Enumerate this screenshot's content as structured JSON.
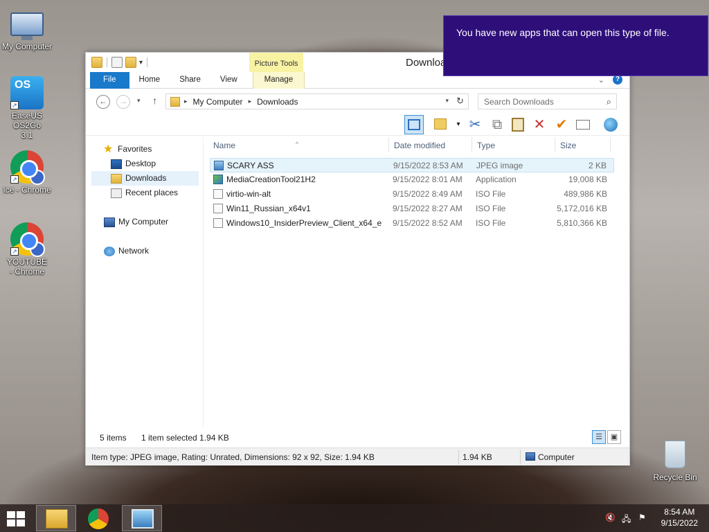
{
  "desktop": {
    "icons": [
      {
        "label": "My Computer"
      },
      {
        "label": "EaseUS OS2Go 3.1"
      },
      {
        "label": "Ice - Chrome"
      },
      {
        "label": "YOUTUBE - Chrome"
      },
      {
        "label": "Recycle Bin"
      }
    ],
    "easeus_logo_text": "OS"
  },
  "notification": {
    "text": "You have new apps that can open this type of file."
  },
  "window": {
    "title": "Downloads",
    "contextual_group": "Picture Tools",
    "tabs": [
      "File",
      "Home",
      "Share",
      "View",
      "Manage"
    ],
    "help_label": "?",
    "address": {
      "crumbs": [
        "My Computer",
        "Downloads"
      ]
    },
    "search": {
      "placeholder": "Search Downloads"
    },
    "nav": {
      "favorites": "Favorites",
      "items": [
        "Desktop",
        "Downloads",
        "Recent places"
      ],
      "computer": "My Computer",
      "network": "Network"
    },
    "columns": [
      "Name",
      "Date modified",
      "Type",
      "Size"
    ],
    "files": [
      {
        "name": "SCARY ASS",
        "date": "9/15/2022 8:53 AM",
        "type": "JPEG image",
        "size": "2 KB",
        "icon": "image-file-icon"
      },
      {
        "name": "MediaCreationTool21H2",
        "date": "9/15/2022 8:01 AM",
        "type": "Application",
        "size": "19,008 KB",
        "icon": "application-icon"
      },
      {
        "name": "virtio-win-alt",
        "date": "9/15/2022 8:49 AM",
        "type": "ISO File",
        "size": "489,986 KB",
        "icon": "iso-file-icon"
      },
      {
        "name": "Win11_Russian_x64v1",
        "date": "9/15/2022 8:27 AM",
        "type": "ISO File",
        "size": "5,172,016 KB",
        "icon": "iso-file-icon"
      },
      {
        "name": "Windows10_InsiderPreview_Client_x64_e...",
        "date": "9/15/2022 8:52 AM",
        "type": "ISO File",
        "size": "5,810,366 KB",
        "icon": "iso-file-icon"
      }
    ],
    "status": {
      "item_count": "5 items",
      "selection": "1 item selected  1.94 KB"
    },
    "details_bar": {
      "info": "Item type: JPEG image, Rating: Unrated, Dimensions: 92 x 92, Size: 1.94 KB",
      "size": "1.94 KB",
      "location": "Computer"
    }
  },
  "taskbar": {
    "time": "8:54 AM",
    "date": "9/15/2022"
  },
  "colors": {
    "file_tab": "#1979ca",
    "notification_bg": "#2e0f7a",
    "picture_tools": "#f8f2a3",
    "selection": "#e5f3fb"
  }
}
